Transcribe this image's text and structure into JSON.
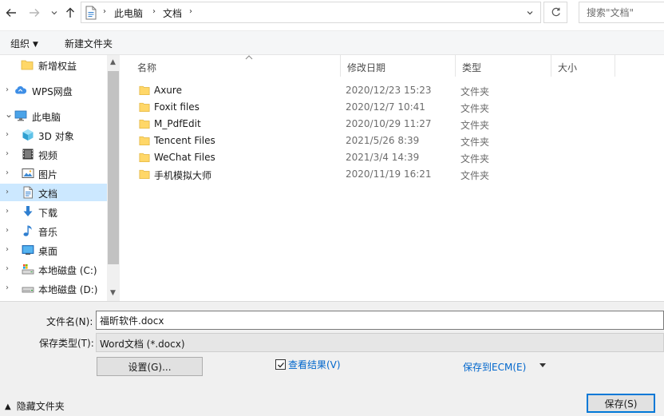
{
  "toolbar": {
    "back_icon": "arrow-left-icon",
    "forward_icon": "arrow-right-icon",
    "recent_icon": "chevron-down-icon",
    "up_icon": "arrow-up-icon"
  },
  "address": {
    "icon": "document-folder-icon",
    "crumbs": [
      "此电脑",
      "文档"
    ],
    "separator": "›",
    "refresh_icon": "refresh-icon"
  },
  "search": {
    "placeholder": "搜索\"文档\""
  },
  "commands": {
    "organize": "组织",
    "new_folder": "新建文件夹"
  },
  "nav": {
    "items": [
      {
        "label": "新增权益",
        "icon": "folder-icon",
        "chevron": ""
      },
      {
        "label": "WPS网盘",
        "icon": "cloud-icon",
        "chevron": "›"
      },
      {
        "label": "此电脑",
        "icon": "computer-icon",
        "chevron": "⌄"
      },
      {
        "label": "3D 对象",
        "icon": "cube-icon",
        "chevron": "›"
      },
      {
        "label": "视频",
        "icon": "video-icon",
        "chevron": "›"
      },
      {
        "label": "图片",
        "icon": "picture-icon",
        "chevron": "›"
      },
      {
        "label": "文档",
        "icon": "document-icon",
        "chevron": "›"
      },
      {
        "label": "下载",
        "icon": "download-icon",
        "chevron": "›"
      },
      {
        "label": "音乐",
        "icon": "music-icon",
        "chevron": "›"
      },
      {
        "label": "桌面",
        "icon": "desktop-icon",
        "chevron": "›"
      },
      {
        "label": "本地磁盘 (C:)",
        "icon": "system-drive-icon",
        "chevron": "›"
      },
      {
        "label": "本地磁盘 (D:)",
        "icon": "drive-icon",
        "chevron": "›"
      }
    ]
  },
  "columns": {
    "name": "名称",
    "date": "修改日期",
    "type": "类型",
    "size": "大小"
  },
  "files": [
    {
      "name": "Axure",
      "date": "2020/12/23 15:23",
      "type": "文件夹"
    },
    {
      "name": "Foxit files",
      "date": "2020/12/7 10:41",
      "type": "文件夹"
    },
    {
      "name": "M_PdfEdit",
      "date": "2020/10/29 11:27",
      "type": "文件夹"
    },
    {
      "name": "Tencent Files",
      "date": "2021/5/26 8:39",
      "type": "文件夹"
    },
    {
      "name": "WeChat Files",
      "date": "2021/3/4 14:39",
      "type": "文件夹"
    },
    {
      "name": "手机模拟大师",
      "date": "2020/11/19 16:21",
      "type": "文件夹"
    }
  ],
  "form": {
    "filename_label": "文件名(N):",
    "filename_value": "福昕软件.docx",
    "filetype_label": "保存类型(T):",
    "filetype_value": "Word文档 (*.docx)",
    "settings_button": "设置(G)...",
    "view_results_label": "查看结果(V)",
    "save_to_ecm": "保存到ECM(E)",
    "hide_folders": "隐藏文件夹",
    "save_button": "保存(S)"
  },
  "colors": {
    "selection": "#cce8ff",
    "link": "#0066cc",
    "folder": "#ffd768",
    "primary_border": "#0078d7"
  }
}
